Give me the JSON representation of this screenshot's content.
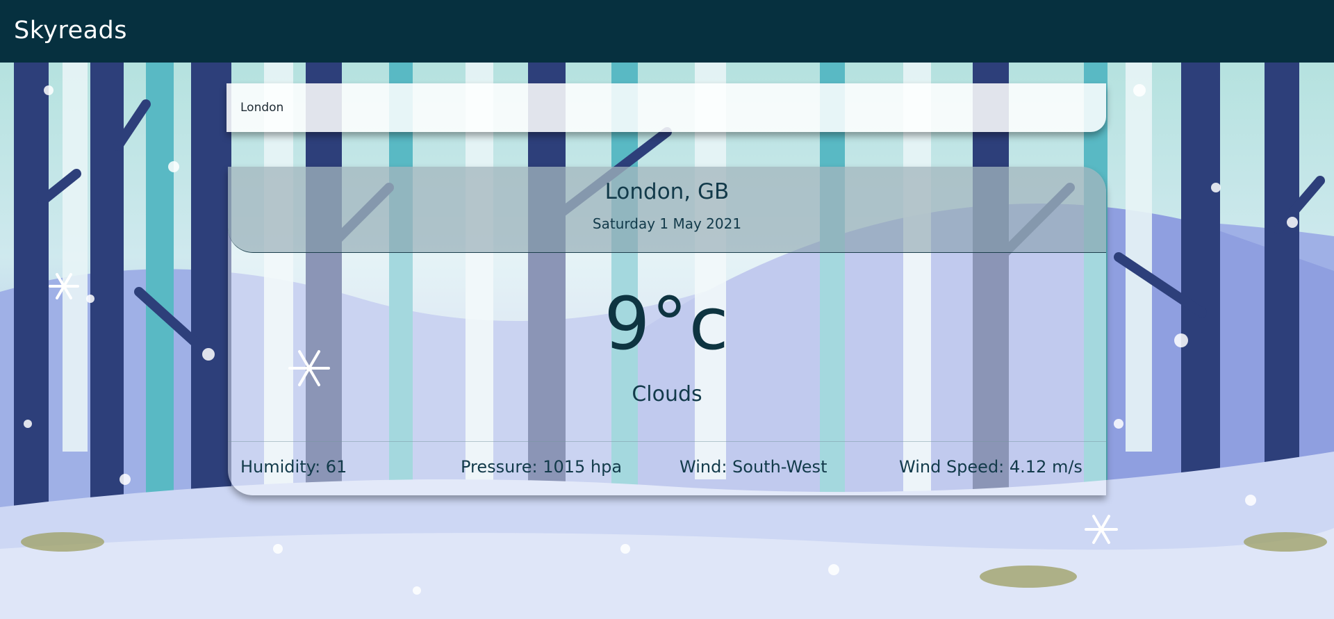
{
  "app": {
    "brand": "Skyreads"
  },
  "search": {
    "value": "London"
  },
  "weather": {
    "location": "London, GB",
    "date": "Saturday 1 May 2021",
    "temperature": "9°c",
    "condition": "Clouds",
    "stats": {
      "humidity": "Humidity: 61",
      "pressure": "Pressure: 1015 hpa",
      "wind": "Wind: South-West",
      "wind_speed": "Wind Speed: 4.12 m/s"
    }
  },
  "colors": {
    "navbar": "#06303f",
    "text": "#123a4a",
    "temp": "#0e3441"
  },
  "icons": {
    "background": "winter-forest-illustration"
  }
}
